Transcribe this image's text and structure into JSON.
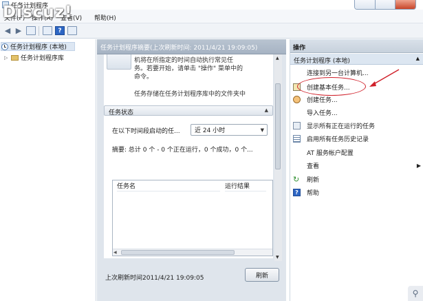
{
  "window": {
    "title": "任务计划程序"
  },
  "watermark": "Discuz!",
  "menu": {
    "items": [
      "文件(F)",
      "操作(A)",
      "查看(V)",
      "帮助(H)"
    ]
  },
  "toolbar": {
    "back_icon": "back-arrow-icon",
    "forward_icon": "forward-arrow-icon",
    "help_glyph": "?"
  },
  "tree": {
    "root_label": "任务计划程序 (本地)",
    "child_label": "任务计划程序库"
  },
  "center": {
    "header": "任务计划程序摘要(上次刷新时间: 2011/4/21 19:09:05)",
    "overview_lines": [
      "机将在所指定的时间自动执行常见任",
      "务。若要开始，请单击 \"操作\" 菜单中的",
      "命令。"
    ],
    "overview_line2": "任务存储在任务计划程序库中的文件夹中",
    "status": {
      "title": "任务状态",
      "filter_label": "在以下时间段启动的任...",
      "filter_value": "近 24 小时",
      "summary": "摘要: 总计 0 个 - 0 个正在运行，0 个成功，0 个...",
      "columns": [
        "任务名",
        "运行结果"
      ]
    },
    "footer": {
      "last_refresh": "上次刷新时间2011/4/21 19:09:05",
      "refresh_button": "刷新"
    }
  },
  "actions": {
    "header": "操作",
    "group_label": "任务计划程序 (本地)",
    "items": [
      {
        "label": "连接到另一台计算机...",
        "icon": "blank"
      },
      {
        "label": "创建基本任务...",
        "icon": "create-basic-task-icon"
      },
      {
        "label": "创建任务...",
        "icon": "create-task-icon"
      },
      {
        "label": "导入任务...",
        "icon": "blank"
      },
      {
        "label": "显示所有正在运行的任务",
        "icon": "running-tasks-icon"
      },
      {
        "label": "启用所有任务历史记录",
        "icon": "history-icon"
      },
      {
        "label": "AT 服务帐户配置",
        "icon": "blank"
      },
      {
        "label": "查看",
        "icon": "blank"
      },
      {
        "label": "刷新",
        "icon": "refresh-icon"
      },
      {
        "label": "帮助",
        "icon": "help-icon"
      }
    ]
  },
  "colors": {
    "annotation": "#d0202a",
    "selection": "#dde7f3",
    "header_bar": "#a6b3c3"
  }
}
